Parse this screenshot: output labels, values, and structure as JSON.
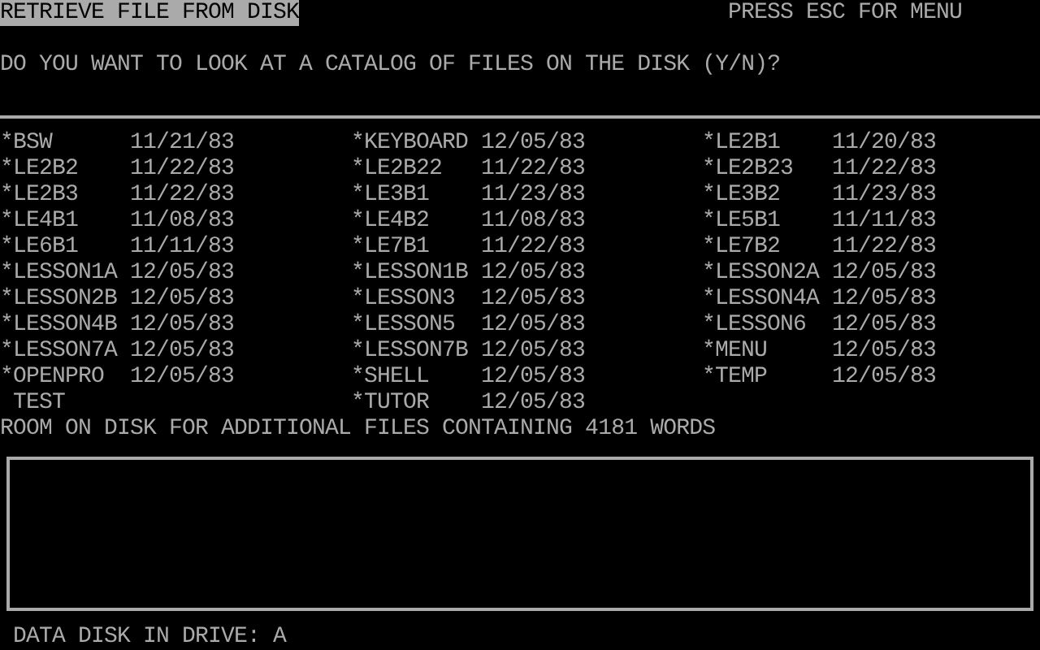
{
  "header": {
    "title": "RETRIEVE FILE FROM DISK",
    "hint": "PRESS ESC FOR MENU"
  },
  "prompt": "DO YOU WANT TO LOOK AT A CATALOG OF FILES ON THE DISK (Y/N)?",
  "files": [
    {
      "mark": "*",
      "name": "BSW",
      "date": "11/21/83"
    },
    {
      "mark": "*",
      "name": "KEYBOARD",
      "date": "12/05/83"
    },
    {
      "mark": "*",
      "name": "LE2B1",
      "date": "11/20/83"
    },
    {
      "mark": "*",
      "name": "LE2B2",
      "date": "11/22/83"
    },
    {
      "mark": "*",
      "name": "LE2B22",
      "date": "11/22/83"
    },
    {
      "mark": "*",
      "name": "LE2B23",
      "date": "11/22/83"
    },
    {
      "mark": "*",
      "name": "LE2B3",
      "date": "11/22/83"
    },
    {
      "mark": "*",
      "name": "LE3B1",
      "date": "11/23/83"
    },
    {
      "mark": "*",
      "name": "LE3B2",
      "date": "11/23/83"
    },
    {
      "mark": "*",
      "name": "LE4B1",
      "date": "11/08/83"
    },
    {
      "mark": "*",
      "name": "LE4B2",
      "date": "11/08/83"
    },
    {
      "mark": "*",
      "name": "LE5B1",
      "date": "11/11/83"
    },
    {
      "mark": "*",
      "name": "LE6B1",
      "date": "11/11/83"
    },
    {
      "mark": "*",
      "name": "LE7B1",
      "date": "11/22/83"
    },
    {
      "mark": "*",
      "name": "LE7B2",
      "date": "11/22/83"
    },
    {
      "mark": "*",
      "name": "LESSON1A",
      "date": "12/05/83"
    },
    {
      "mark": "*",
      "name": "LESSON1B",
      "date": "12/05/83"
    },
    {
      "mark": "*",
      "name": "LESSON2A",
      "date": "12/05/83"
    },
    {
      "mark": "*",
      "name": "LESSON2B",
      "date": "12/05/83"
    },
    {
      "mark": "*",
      "name": "LESSON3",
      "date": "12/05/83"
    },
    {
      "mark": "*",
      "name": "LESSON4A",
      "date": "12/05/83"
    },
    {
      "mark": "*",
      "name": "LESSON4B",
      "date": "12/05/83"
    },
    {
      "mark": "*",
      "name": "LESSON5",
      "date": "12/05/83"
    },
    {
      "mark": "*",
      "name": "LESSON6",
      "date": "12/05/83"
    },
    {
      "mark": "*",
      "name": "LESSON7A",
      "date": "12/05/83"
    },
    {
      "mark": "*",
      "name": "LESSON7B",
      "date": "12/05/83"
    },
    {
      "mark": "*",
      "name": "MENU",
      "date": "12/05/83"
    },
    {
      "mark": "*",
      "name": "OPENPRO",
      "date": "12/05/83"
    },
    {
      "mark": "*",
      "name": "SHELL",
      "date": "12/05/83"
    },
    {
      "mark": "*",
      "name": "TEMP",
      "date": "12/05/83"
    },
    {
      "name": "TEST"
    },
    {
      "mark": "*",
      "name": "TUTOR",
      "date": "12/05/83"
    }
  ],
  "free_space": "ROOM ON DISK FOR ADDITIONAL FILES CONTAINING 4181 WORDS",
  "status": "DATA DISK IN DRIVE: A"
}
